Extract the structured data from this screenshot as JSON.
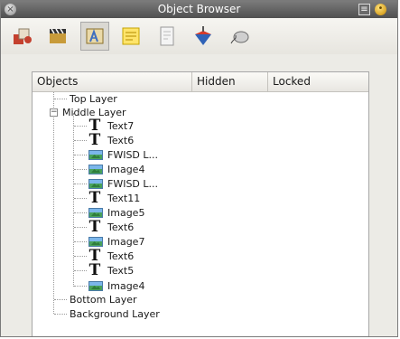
{
  "window": {
    "title": "Object Browser"
  },
  "toolbar": {
    "tools": [
      {
        "icon": "shapes-tool-icon"
      },
      {
        "icon": "clapperboard-tool-icon"
      },
      {
        "icon": "text-tool-icon",
        "active": true
      },
      {
        "icon": "notes-tool-icon"
      },
      {
        "icon": "document-tool-icon"
      },
      {
        "icon": "spinning-top-tool-icon"
      },
      {
        "icon": "mouse-tool-icon"
      }
    ]
  },
  "table": {
    "columns": [
      "Objects",
      "Hidden",
      "Locked"
    ]
  },
  "tree": {
    "top_layer": "Top Layer",
    "middle_layer": "Middle Layer",
    "children": [
      {
        "type": "text",
        "label": "Text7"
      },
      {
        "type": "text",
        "label": "Text6"
      },
      {
        "type": "image",
        "label": "FWISD L..."
      },
      {
        "type": "image",
        "label": "Image4"
      },
      {
        "type": "image",
        "label": "FWISD L..."
      },
      {
        "type": "text",
        "label": "Text11"
      },
      {
        "type": "image",
        "label": "Image5"
      },
      {
        "type": "text",
        "label": "Text6"
      },
      {
        "type": "image",
        "label": "Image7"
      },
      {
        "type": "text",
        "label": "Text6"
      },
      {
        "type": "text",
        "label": "Text5"
      },
      {
        "type": "image",
        "label": "Image4"
      }
    ],
    "bottom_layer": "Bottom Layer",
    "background_layer": "Background Layer"
  },
  "colors": {
    "titlebar": "#5f5f5f",
    "toolbar": "#ecebe6",
    "panel": "#ffffff"
  }
}
